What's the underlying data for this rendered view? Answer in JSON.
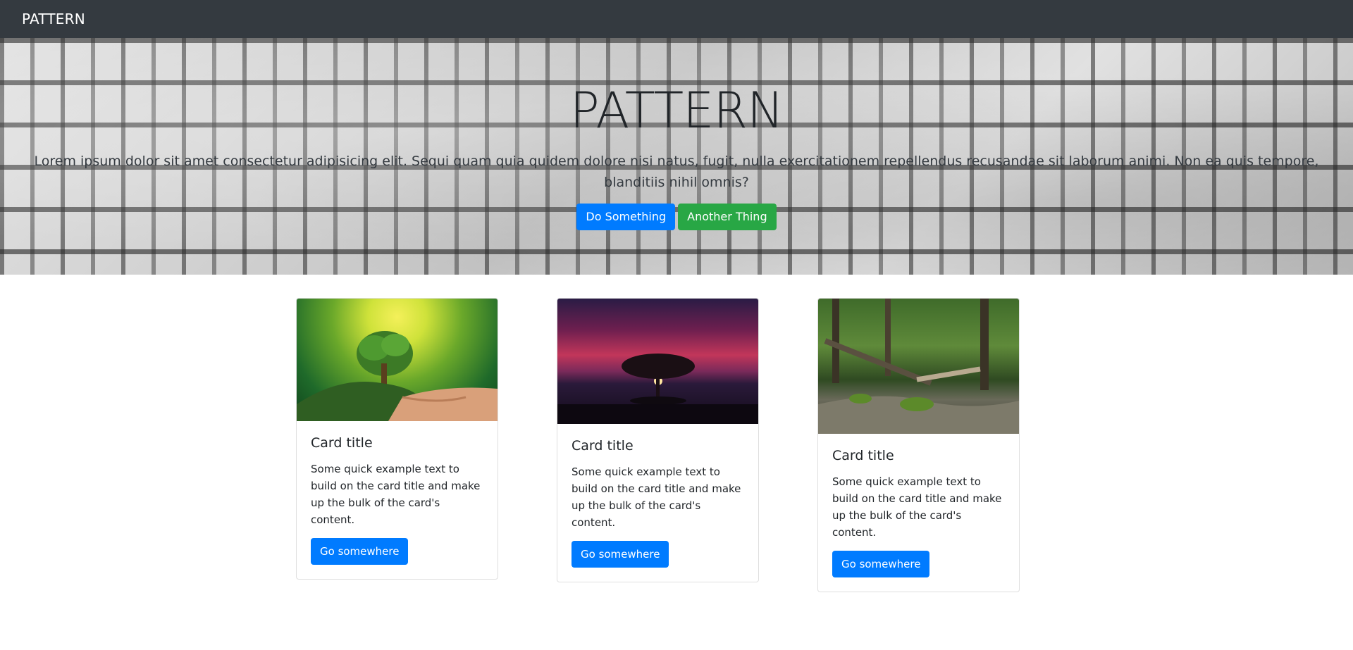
{
  "navbar": {
    "brand": "PATTERN"
  },
  "hero": {
    "title": "PATTERN",
    "text": "Lorem ipsum dolor sit amet consectetur adipisicing elit. Sequi quam quia quidem dolore nisi natus, fugit, nulla exercitationem repellendus recusandae sit laborum animi. Non ea quis tempore, blanditiis nihil omnis?",
    "buttons": {
      "primary": "Do Something",
      "secondary": "Another Thing"
    }
  },
  "cards": [
    {
      "title": "Card title",
      "text": "Some quick example text to build on the card title and make up the bulk of the card's content.",
      "button": "Go somewhere",
      "image": "tree-in-hands"
    },
    {
      "title": "Card title",
      "text": "Some quick example text to build on the card title and make up the bulk of the card's content.",
      "button": "Go somewhere",
      "image": "tree-at-sunset"
    },
    {
      "title": "Card title",
      "text": "Some quick example text to build on the card title and make up the bulk of the card's content.",
      "button": "Go somewhere",
      "image": "forest-stream"
    }
  ],
  "colors": {
    "navbar": "#343a40",
    "primary": "#007bff",
    "success": "#28a745"
  }
}
